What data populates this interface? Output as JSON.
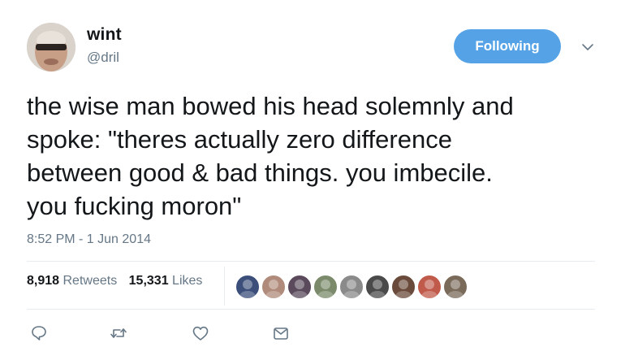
{
  "user": {
    "display_name": "wint",
    "handle": "@dril"
  },
  "follow_button": {
    "label": "Following",
    "color": "#55a3e6"
  },
  "tweet": {
    "text": "the wise man bowed his head solemnly and\nspoke: \"theres actually zero difference\nbetween good & bad things. you imbecile.\nyou fucking moron\"",
    "timestamp": "8:52 PM - 1 Jun 2014"
  },
  "stats": {
    "retweets_count": "8,918",
    "retweets_label": "Retweets",
    "likes_count": "15,331",
    "likes_label": "Likes"
  },
  "liked_by_avatars": [
    {
      "name": "liker-avatar-1",
      "color": "#3b4f7a"
    },
    {
      "name": "liker-avatar-2",
      "color": "#b08a7a"
    },
    {
      "name": "liker-avatar-3",
      "color": "#5a4a5c"
    },
    {
      "name": "liker-avatar-4",
      "color": "#7a8a6a"
    },
    {
      "name": "liker-avatar-5",
      "color": "#8a8a8a"
    },
    {
      "name": "liker-avatar-6",
      "color": "#4a4a4a"
    },
    {
      "name": "liker-avatar-7",
      "color": "#6a4a3a"
    },
    {
      "name": "liker-avatar-8",
      "color": "#c05a4a"
    },
    {
      "name": "liker-avatar-9",
      "color": "#7a6a5a"
    }
  ],
  "actions": [
    {
      "name": "reply-icon"
    },
    {
      "name": "retweet-icon"
    },
    {
      "name": "like-icon"
    },
    {
      "name": "direct-message-icon"
    }
  ],
  "colors": {
    "text": "#14171a",
    "secondary": "#657786",
    "divider": "#e6ecf0",
    "icon": "#657786"
  }
}
